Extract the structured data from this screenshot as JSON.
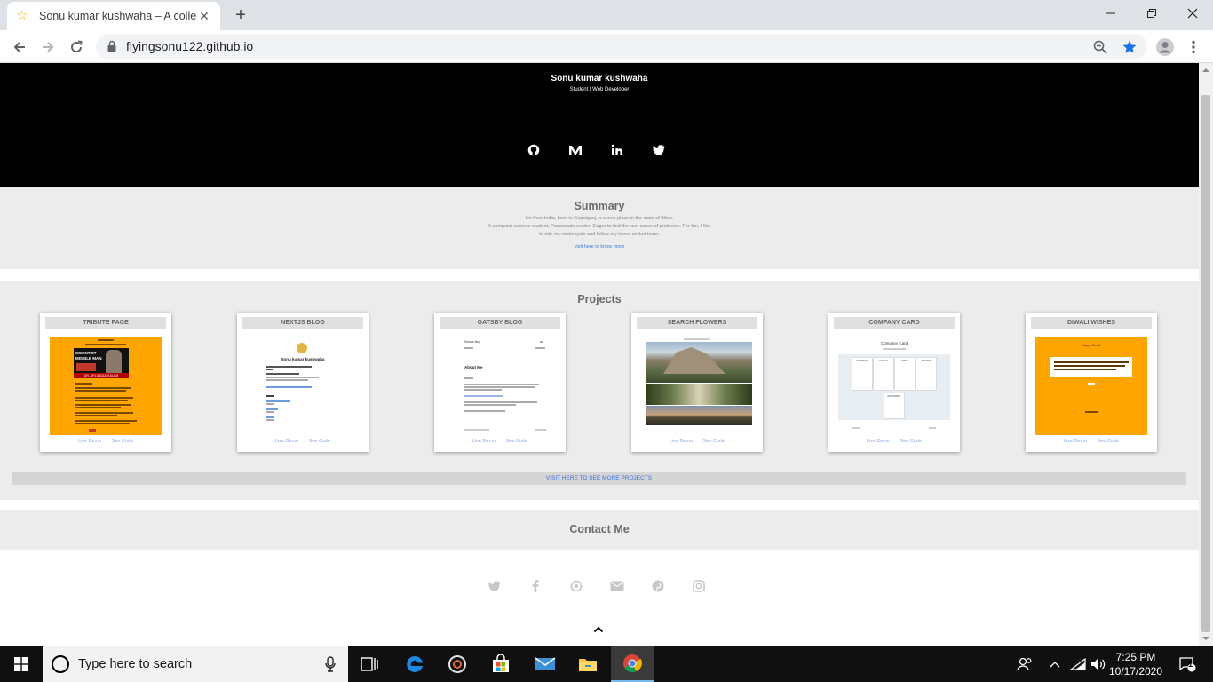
{
  "browser": {
    "tab_title": "Sonu kumar kushwaha – A collection",
    "url": "flyingsonu122.github.io"
  },
  "hero": {
    "name": "Sonu kumar kushwaha",
    "subtitle": "Student | Web Developer",
    "social_icons": [
      "github-icon",
      "medium-icon",
      "linkedin-icon",
      "twitter-icon"
    ]
  },
  "summary": {
    "heading": "Summary",
    "line1": "I'm from India, born in Gopalganj, a sunny place in the state of Bihar.",
    "line2": "A computer science student, Passionate reader. Eager to find the root cause of problems. For fun, I like",
    "line3": "to ride my motorcycle and follow my home cricket team.",
    "link": "visit here to know more"
  },
  "projects": {
    "heading": "Projects",
    "cards": [
      {
        "title": "TRIBUTE PAGE",
        "demo": "Live Demo",
        "code": "See Code"
      },
      {
        "title": "NEXTJS BLOG",
        "demo": "Live Demo",
        "code": "See Code"
      },
      {
        "title": "GATSBY BLOG",
        "demo": "Live Demo",
        "code": "See Code"
      },
      {
        "title": "SEARCH FLOWERS",
        "demo": "Live Demo",
        "code": "See Code"
      },
      {
        "title": "COMPANY CARD",
        "demo": "Live Demo",
        "code": "See Code"
      },
      {
        "title": "DIWALI WISHES",
        "demo": "Live Demo",
        "code": "See Code"
      }
    ],
    "thumbs": {
      "tribute_banner_1": "SCIENTIST",
      "tribute_banner_2": "MISSILE MAN",
      "tribute_banner_3": "DR. APJ ABDUL KALAM",
      "nextjs_heading": "Sonu kumar kushwaha",
      "gatsby_brand": "Sonu's blog",
      "gatsby_about": "About Me",
      "company_heading": "Company Card",
      "company_cells": [
        "FACEBOOK",
        "GOOGLE",
        "APPLE",
        "AMAZON",
        "MICROSOFT"
      ],
      "diwali_title": "Happy Diwali"
    },
    "more_link": "VISIT HERE TO SEE MORE PROJECTS"
  },
  "contact": {
    "heading": "Contact Me",
    "social_icons": [
      "twitter-icon",
      "facebook-icon",
      "whatsapp-icon",
      "mail-icon",
      "pinterest-icon",
      "instagram-icon"
    ]
  },
  "taskbar": {
    "search_placeholder": "Type here to search",
    "time": "7:25 PM",
    "date": "10/17/2020",
    "notification_count": "1"
  },
  "colors": {
    "hero_bg": "#000000",
    "section_bg": "#ececec",
    "link": "#3b7ddd",
    "tribute_bg": "#ffa500",
    "diwali_bg": "#ffa500"
  }
}
